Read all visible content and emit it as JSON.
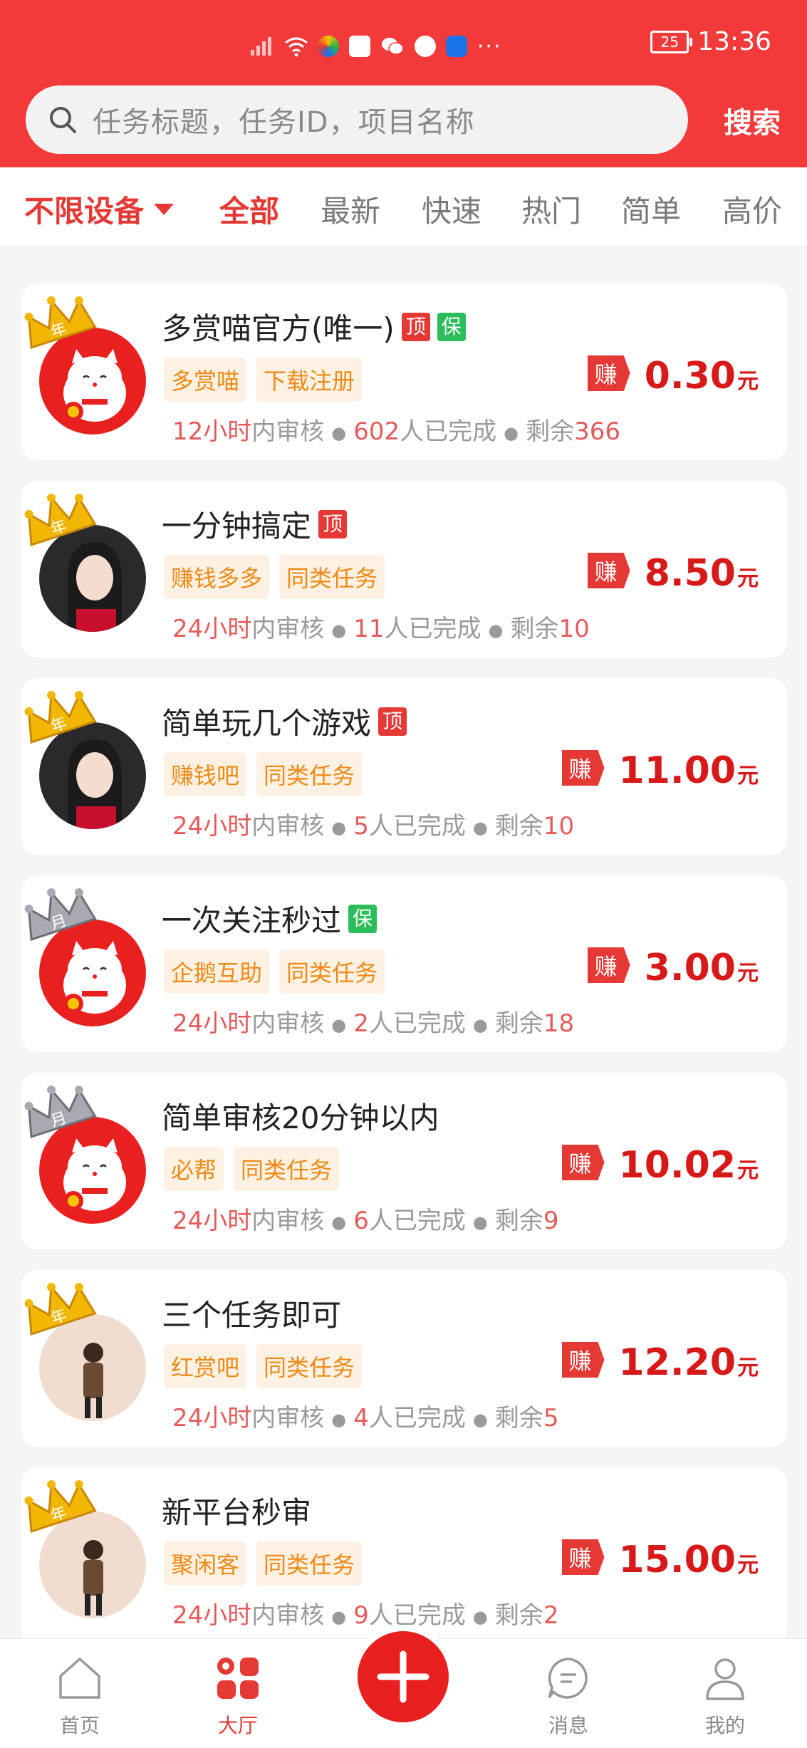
{
  "status_bar": {
    "time": "13:36",
    "battery": "25"
  },
  "search": {
    "placeholder": "任务标题，任务ID，项目名称",
    "button": "搜索"
  },
  "filter": {
    "device": "不限设备",
    "tabs": [
      "全部",
      "最新",
      "快速",
      "热门",
      "简单",
      "高价"
    ]
  },
  "tasks": [
    {
      "title": "多赏喵官方(唯一)",
      "badges": [
        "顶",
        "保"
      ],
      "tags": [
        "多赏喵",
        "下载注册"
      ],
      "review": "12小时",
      "review_suffix": "内审核",
      "done": "602",
      "done_suffix": "人已完成",
      "remain_prefix": "剩余",
      "remain": "366",
      "earn": "赚",
      "amount": "0.30",
      "unit": "元",
      "crown_label": "年",
      "avatar": "cat"
    },
    {
      "title": "一分钟搞定",
      "badges": [
        "顶"
      ],
      "tags": [
        "赚钱多多",
        "同类任务"
      ],
      "review": "24小时",
      "review_suffix": "内审核",
      "done": "11",
      "done_suffix": "人已完成",
      "remain_prefix": "剩余",
      "remain": "10",
      "earn": "赚",
      "amount": "8.50",
      "unit": "元",
      "crown_label": "年",
      "avatar": "girl"
    },
    {
      "title": "简单玩几个游戏",
      "badges": [
        "顶"
      ],
      "tags": [
        "赚钱吧",
        "同类任务"
      ],
      "review": "24小时",
      "review_suffix": "内审核",
      "done": "5",
      "done_suffix": "人已完成",
      "remain_prefix": "剩余",
      "remain": "10",
      "earn": "赚",
      "amount": "11.00",
      "unit": "元",
      "crown_label": "年",
      "avatar": "girl"
    },
    {
      "title": "一次关注秒过",
      "badges": [
        "保"
      ],
      "tags": [
        "企鹅互助",
        "同类任务"
      ],
      "review": "24小时",
      "review_suffix": "内审核",
      "done": "2",
      "done_suffix": "人已完成",
      "remain_prefix": "剩余",
      "remain": "18",
      "earn": "赚",
      "amount": "3.00",
      "unit": "元",
      "crown_label": "月",
      "avatar": "cat"
    },
    {
      "title": "简单审核20分钟以内",
      "badges": [],
      "tags": [
        "必帮",
        "同类任务"
      ],
      "review": "24小时",
      "review_suffix": "内审核",
      "done": "6",
      "done_suffix": "人已完成",
      "remain_prefix": "剩余",
      "remain": "9",
      "earn": "赚",
      "amount": "10.02",
      "unit": "元",
      "crown_label": "月",
      "avatar": "cat"
    },
    {
      "title": "三个任务即可",
      "badges": [],
      "tags": [
        "红赏吧",
        "同类任务"
      ],
      "review": "24小时",
      "review_suffix": "内审核",
      "done": "4",
      "done_suffix": "人已完成",
      "remain_prefix": "剩余",
      "remain": "5",
      "earn": "赚",
      "amount": "12.20",
      "unit": "元",
      "crown_label": "年",
      "avatar": "person"
    },
    {
      "title": "新平台秒审",
      "badges": [],
      "tags": [
        "聚闲客",
        "同类任务"
      ],
      "review": "24小时",
      "review_suffix": "内审核",
      "done": "9",
      "done_suffix": "人已完成",
      "remain_prefix": "剩余",
      "remain": "2",
      "earn": "赚",
      "amount": "15.00",
      "unit": "元",
      "crown_label": "年",
      "avatar": "person"
    }
  ],
  "nav": {
    "home": "首页",
    "hall": "大厅",
    "messages": "消息",
    "mine": "我的"
  },
  "colors": {
    "brand_red": "#f23a3a",
    "accent_red": "#e53935",
    "tag_orange": "#ef8a16",
    "badge_green": "#2bbd5a"
  }
}
